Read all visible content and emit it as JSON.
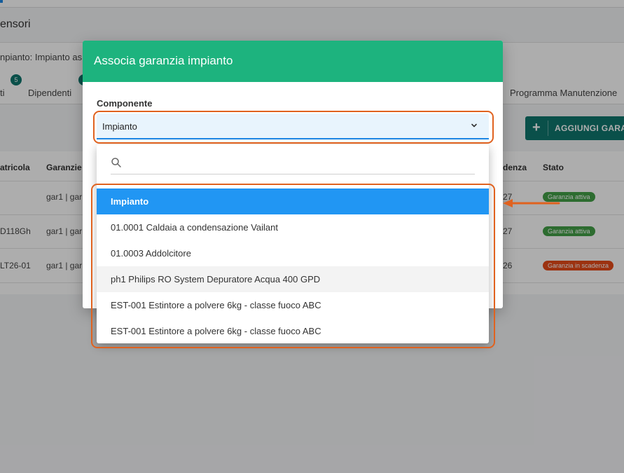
{
  "page": {
    "title_fragment": "ensori",
    "breadcrumb_fragment": "npianto: Impianto as",
    "tabs": [
      {
        "label": "ti"
      },
      {
        "label": "Dipendenti",
        "badge": "5"
      },
      {
        "label": "Programma Manutenzione"
      }
    ],
    "add_button_label": "AGGIUNGI GARAN",
    "table": {
      "headers": [
        "atricola",
        "Garanzie",
        "denza",
        "Stato"
      ],
      "rows": [
        {
          "matricola": "",
          "garanzie": "gar1 | gar",
          "scadenza": "27",
          "stato": "Garanzia attiva",
          "stato_color": "#43a047"
        },
        {
          "matricola": "D118Gh",
          "garanzie": "gar1 | gar",
          "scadenza": "27",
          "stato": "Garanzia attiva",
          "stato_color": "#43a047"
        },
        {
          "matricola": "LT26-01",
          "garanzie": "gar1 | gar",
          "scadenza": "26",
          "stato": "Garanzia in scadenza",
          "stato_color": "#e64a19"
        }
      ]
    }
  },
  "modal": {
    "title": "Associa garanzia impianto",
    "field_label": "Componente",
    "selected_value": "Impianto",
    "search_placeholder": "",
    "options": [
      {
        "label": "Impianto",
        "state": "selected"
      },
      {
        "label": "01.0001 Caldaia a condensazione Vailant",
        "state": "normal"
      },
      {
        "label": "01.0003 Addolcitore",
        "state": "normal"
      },
      {
        "label": "ph1 Philips RO System Depuratore Acqua 400 GPD",
        "state": "hover"
      },
      {
        "label": "EST-001 Estintore a polvere 6kg - classe fuoco ABC",
        "state": "normal"
      },
      {
        "label": "EST-001 Estintore a polvere 6kg - classe fuoco ABC",
        "state": "normal"
      }
    ]
  },
  "colors": {
    "header_green": "#1db37e",
    "selected_blue": "#2196f3",
    "annotation_orange": "#e0621f",
    "teal_button": "#0f766e"
  }
}
